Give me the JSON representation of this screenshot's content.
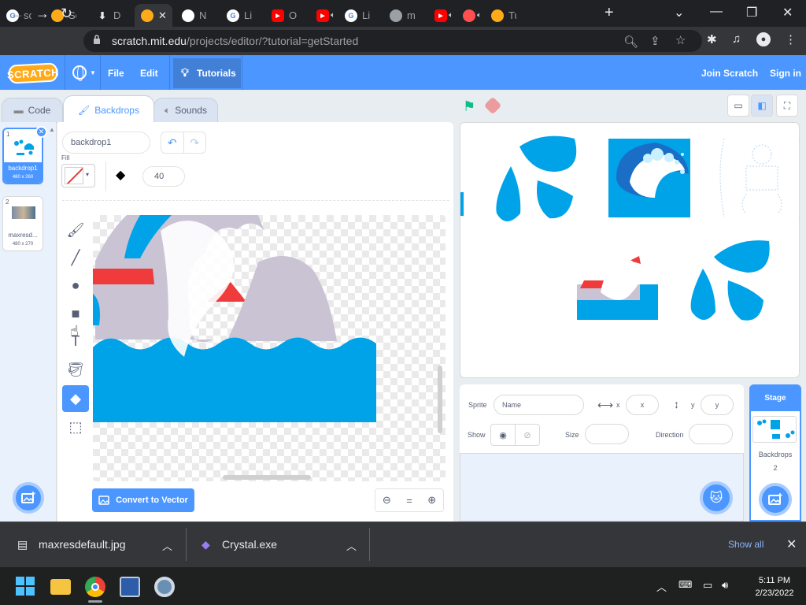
{
  "browser": {
    "tabs": [
      {
        "label": "scra",
        "favicon": "google-icon"
      },
      {
        "label": "Scra",
        "favicon": "scratch-icon"
      },
      {
        "label": "Dov",
        "favicon": "download-icon"
      },
      {
        "label": "",
        "favicon": "scratch-icon",
        "active": true
      },
      {
        "label": "Nev",
        "favicon": "github-icon"
      },
      {
        "label": "Live",
        "favicon": "google-icon"
      },
      {
        "label": "Offi",
        "favicon": "youtube-icon"
      },
      {
        "label": "",
        "favicon": "youtube-icon"
      },
      {
        "label": "Live",
        "favicon": "google-icon"
      },
      {
        "label": "ma",
        "favicon": "globe-icon"
      },
      {
        "label": "",
        "favicon": "youtube-icon"
      },
      {
        "label": "",
        "favicon": "tutorial-icon"
      },
      {
        "label": "Tur",
        "favicon": "scratch-icon"
      }
    ],
    "url_host": "scratch.mit.edu",
    "url_path": "/projects/editor/?tutorial=getStarted"
  },
  "menu": {
    "logo": "SCRATCH",
    "file": "File",
    "edit": "Edit",
    "tutorials": "Tutorials",
    "join": "Join Scratch",
    "signin": "Sign in"
  },
  "editor_tabs": {
    "code": "Code",
    "backdrops": "Backdrops",
    "sounds": "Sounds"
  },
  "costumes": [
    {
      "num": "1",
      "name": "backdrop1",
      "dims": "480 x 260",
      "selected": true
    },
    {
      "num": "2",
      "name": "maxresd...",
      "dims": "480 x 270",
      "selected": false
    }
  ],
  "paint": {
    "costume_name": "backdrop1",
    "fill_label": "Fill",
    "brush_size": "40",
    "convert_label": "Convert to Vector",
    "zoom_reset": "="
  },
  "sprite_info": {
    "sprite_label": "Sprite",
    "name_placeholder": "Name",
    "x_label": "x",
    "x_placeholder": "x",
    "y_label": "y",
    "y_placeholder": "y",
    "show_label": "Show",
    "size_label": "Size",
    "direction_label": "Direction"
  },
  "stage_target": {
    "header": "Stage",
    "backdrops_label": "Backdrops",
    "backdrops_count": "2"
  },
  "downloads": {
    "items": [
      {
        "name": "maxresdefault.jpg",
        "icon": "file-icon"
      },
      {
        "name": "Crystal.exe",
        "icon": "crystal-icon"
      }
    ],
    "show_all": "Show all"
  },
  "taskbar": {
    "time": "5:11 PM",
    "date": "2/23/2022"
  },
  "colors": {
    "scratch_blue": "#4c97ff",
    "water_blue": "#00a2e8",
    "boat_red": "#ef3b3b",
    "chrome_dark": "#202124"
  }
}
